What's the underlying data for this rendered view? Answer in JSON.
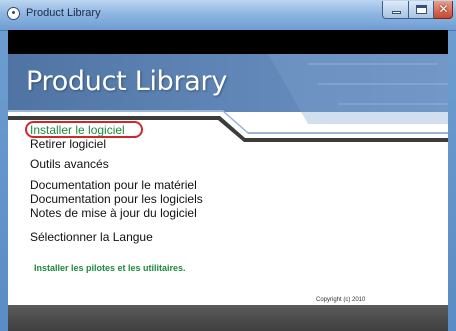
{
  "window": {
    "title": "Product Library",
    "controls": {
      "minimize": "minimize-icon",
      "maximize": "maximize-icon",
      "close": "close-icon"
    }
  },
  "banner": {
    "title": "Product Library"
  },
  "menu": {
    "items": [
      {
        "label": "Installer le logiciel",
        "highlighted": true
      },
      {
        "label": "Retirer logiciel"
      },
      {
        "label": "Outils avancés"
      },
      {
        "label": "Documentation pour le matériel"
      },
      {
        "label": "Documentation pour les logiciels"
      },
      {
        "label": "Notes de mise à jour du logiciel"
      },
      {
        "label": "Sélectionner la Langue"
      }
    ]
  },
  "status": {
    "text": "Installer les pilotes et les utilitaires."
  },
  "footer": {
    "copyright": "Copyright (c) 2010"
  },
  "colors": {
    "accent_green": "#1e8a3e",
    "highlight_red": "#d3262b",
    "banner_blue": "#5e84b5",
    "title_bar_blue": "#8fb6e2"
  }
}
